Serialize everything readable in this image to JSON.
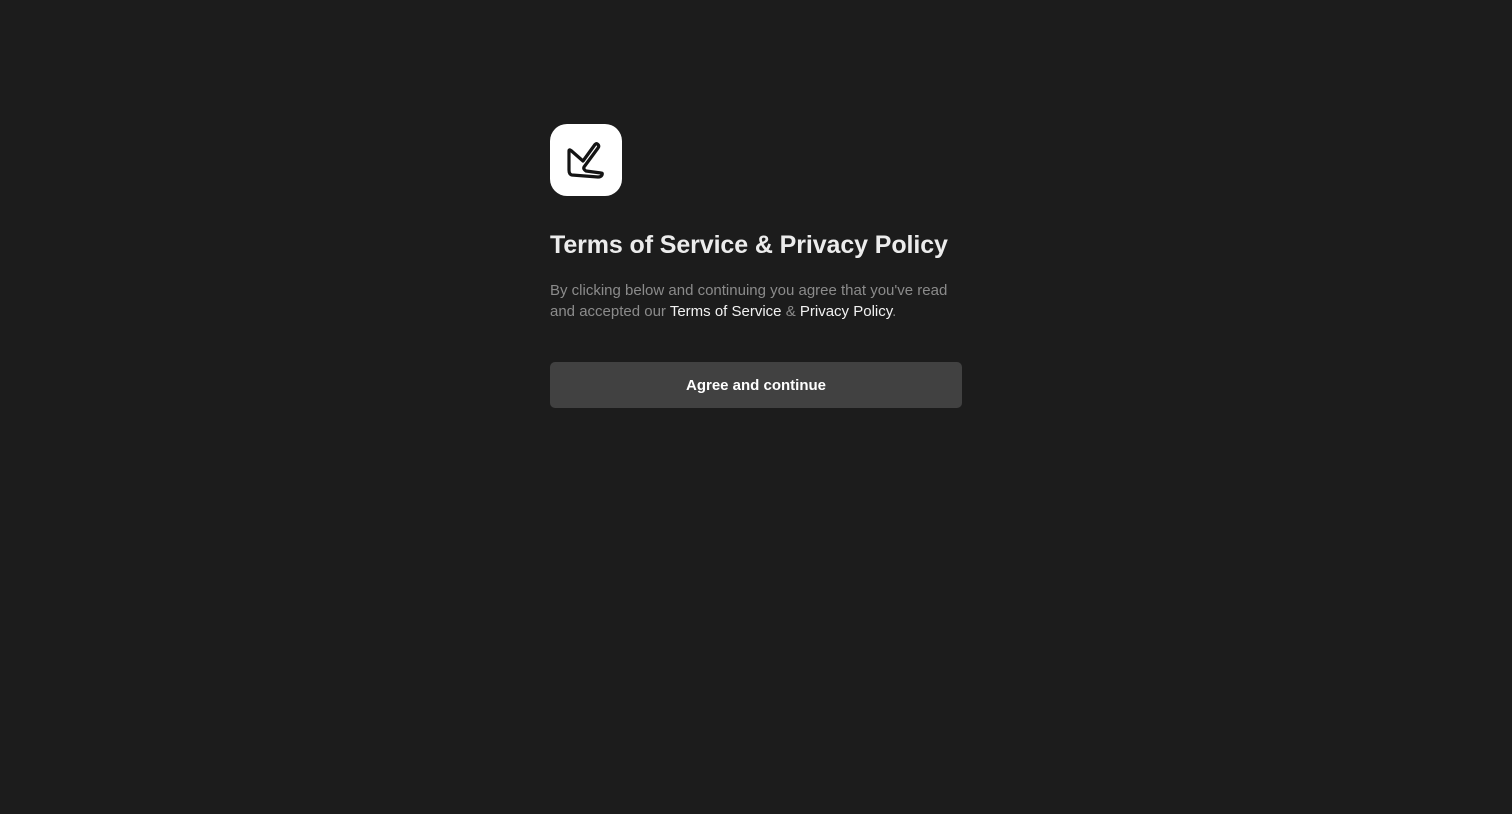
{
  "logo": {
    "icon": "app-logo-icon",
    "background": "#ffffff",
    "stroke": "#141414"
  },
  "title": "Terms of Service & Privacy Policy",
  "description": {
    "text_before": "By clicking below and continuing you agree that you've read and accepted our ",
    "terms_link": "Terms of Service",
    "separator": " & ",
    "privacy_link": "Privacy Policy",
    "text_after": "."
  },
  "button": {
    "label": "Agree and continue"
  },
  "colors": {
    "background": "#1c1c1c",
    "button": "#414141",
    "muted_text": "#8b8b8b",
    "title_text": "#ececec"
  }
}
